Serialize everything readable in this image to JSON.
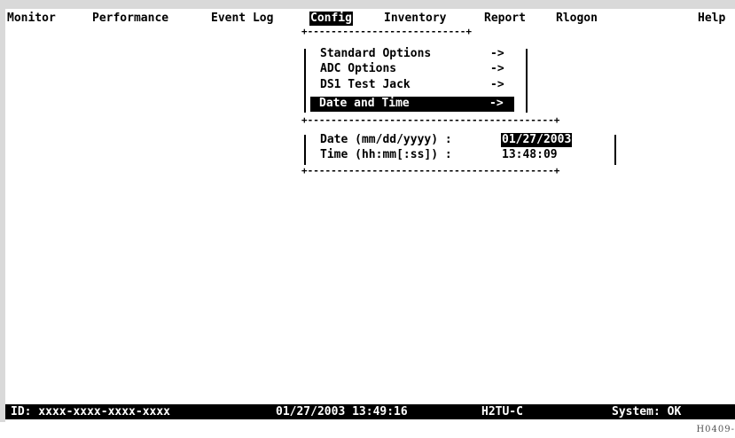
{
  "menubar": {
    "items": [
      "Monitor",
      "Performance",
      "Event Log",
      "Config",
      "Inventory",
      "Report",
      "Rlogon"
    ],
    "help": "Help",
    "active_item": "Config"
  },
  "submenu": {
    "items": [
      "Standard Options",
      "ADC Options",
      "DS1 Test Jack",
      "Date and Time"
    ],
    "arrow": "->",
    "selected_item": "Date and Time"
  },
  "datetime_dialog": {
    "date_label": "Date (mm/dd/yyyy) :",
    "date_value": "01/27/2003",
    "time_label": "Time (hh:mm[:ss]) :",
    "time_value": "13:48:09"
  },
  "status_bar": {
    "id": "ID: xxxx-xxxx-xxxx-xxxx",
    "datetime": "01/27/2003 13:49:16",
    "unit": "H2TU-C",
    "system": "System: OK"
  },
  "figure_code": "H0409-"
}
